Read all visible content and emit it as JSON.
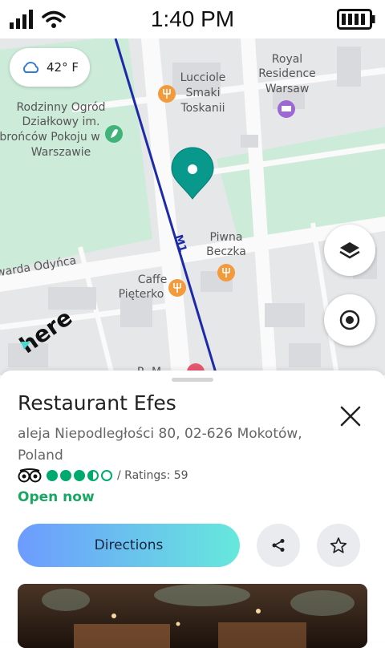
{
  "status_bar": {
    "time": "1:40 PM"
  },
  "weather": {
    "temperature": "42° F",
    "icon": "cloud-icon"
  },
  "map": {
    "labels": {
      "royal_residence": [
        "Royal",
        "Residence",
        "Warsaw"
      ],
      "lucciole": [
        "Lucciole",
        "Smaki",
        "Toskanii"
      ],
      "ogrod": [
        "Rodzinny Ogród",
        "Działkowy im.",
        "brońców Pokoju w",
        "Warszawie"
      ],
      "piwna": [
        "Piwna",
        "Beczka"
      ],
      "caffe": [
        "Caffe",
        "Pięterko"
      ],
      "street": "warda Odyńca",
      "line": "M1",
      "partial": "R. M"
    },
    "logo": "here",
    "colors": {
      "park": "#cdebd9",
      "route": "#1d2aa8",
      "pin": "#08998c",
      "poi": "#f39b3c"
    }
  },
  "place": {
    "name": "Restaurant Efes",
    "address": "aleja Niepodległości 80, 02-626 Mokotów, Poland",
    "ratings_text": "/ Ratings: 59",
    "rating_value": 3.5,
    "open_status": "Open now"
  },
  "actions": {
    "directions": "Directions",
    "share_icon": "share-icon",
    "favorite_icon": "star-icon"
  }
}
